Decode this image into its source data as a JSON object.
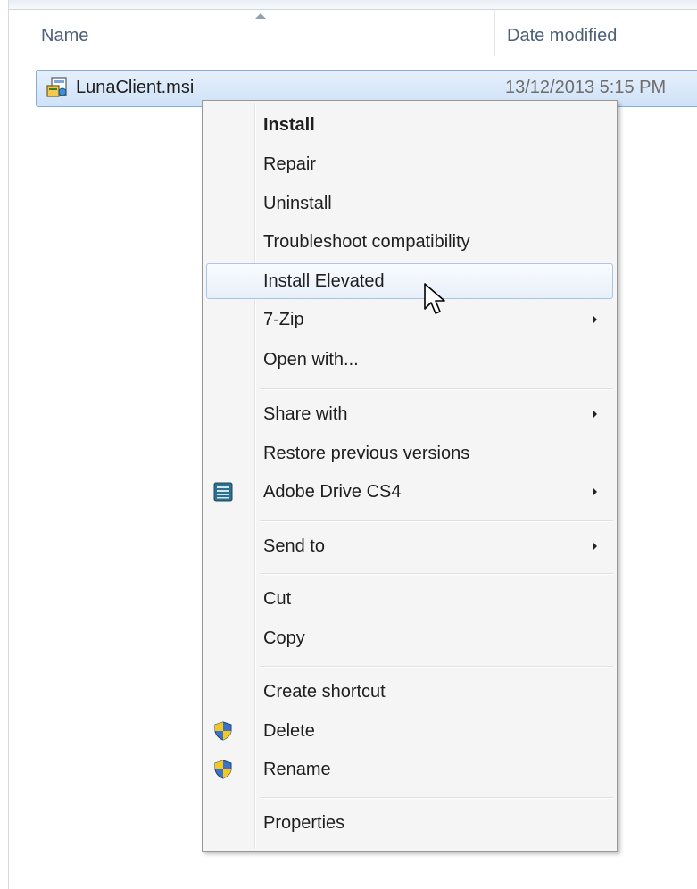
{
  "columns": {
    "name_label": "Name",
    "date_label": "Date modified"
  },
  "file": {
    "name": "LunaClient.msi",
    "date_modified": "13/12/2013 5:15 PM",
    "icon": "msi-installer-icon"
  },
  "context_menu": {
    "items": [
      {
        "label": "Install",
        "bold": true
      },
      {
        "label": "Repair"
      },
      {
        "label": "Uninstall"
      },
      {
        "label": "Troubleshoot compatibility"
      },
      {
        "label": "Install Elevated",
        "hovered": true
      },
      {
        "label": "7-Zip",
        "submenu": true
      },
      {
        "label": "Open with..."
      },
      {
        "label": "Share with",
        "submenu": true
      },
      {
        "label": "Restore previous versions"
      },
      {
        "label": "Adobe Drive CS4",
        "submenu": true,
        "icon": "adobe-drive-icon"
      },
      {
        "label": "Send to",
        "submenu": true
      },
      {
        "label": "Cut"
      },
      {
        "label": "Copy"
      },
      {
        "label": "Create shortcut"
      },
      {
        "label": "Delete",
        "icon": "uac-shield-icon"
      },
      {
        "label": "Rename",
        "icon": "uac-shield-icon"
      },
      {
        "label": "Properties"
      }
    ]
  },
  "colors": {
    "selection_border": "#84acdd",
    "selection_fill": "#cfe2f8",
    "hover_border": "#a8c6ea",
    "menu_background": "#f5f5f5",
    "header_text": "#4c607a"
  }
}
